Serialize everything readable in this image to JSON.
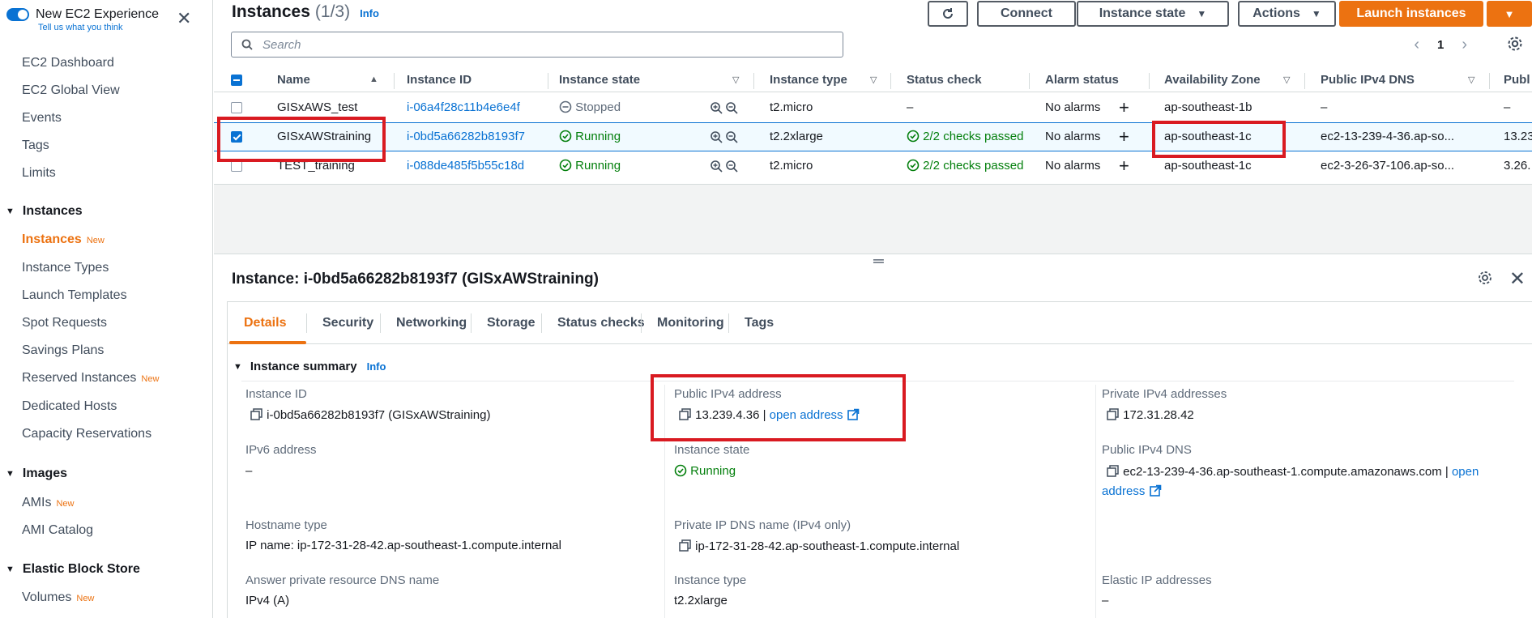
{
  "sidebar": {
    "toggle_title": "New EC2 Experience",
    "toggle_sub": "Tell us what you think",
    "items_top": [
      "EC2 Dashboard",
      "EC2 Global View",
      "Events",
      "Tags",
      "Limits"
    ],
    "section_instances": "Instances",
    "instances_items": [
      "Instances",
      "Instance Types",
      "Launch Templates",
      "Spot Requests",
      "Savings Plans",
      "Reserved Instances",
      "Dedicated Hosts",
      "Capacity Reservations"
    ],
    "section_images": "Images",
    "images_items": [
      "AMIs",
      "AMI Catalog"
    ],
    "section_ebs": "Elastic Block Store",
    "ebs_items": [
      "Volumes"
    ],
    "new_badge": "New"
  },
  "header": {
    "title": "Instances",
    "count": "(1/3)",
    "info": "Info",
    "connect": "Connect",
    "instance_state": "Instance state",
    "actions": "Actions",
    "launch": "Launch instances",
    "search_placeholder": "Search",
    "page": "1"
  },
  "table": {
    "columns": [
      "Name",
      "Instance ID",
      "Instance state",
      "Instance type",
      "Status check",
      "Alarm status",
      "Availability Zone",
      "Public IPv4 DNS",
      "Publ"
    ],
    "rows": [
      {
        "name": "GISxAWS_test",
        "id": "i-06a4f28c11b4e6e4f",
        "state": "Stopped",
        "type": "t2.micro",
        "status": "–",
        "alarm": "No alarms",
        "az_prefix": "ap-southeast-",
        "az_suffix": "1b",
        "dns": "–",
        "ip": "–"
      },
      {
        "name": "GISxAWStraining",
        "id": "i-0bd5a66282b8193f7",
        "state": "Running",
        "type": "t2.2xlarge",
        "status": "2/2 checks passed",
        "alarm": "No alarms",
        "az_prefix": "ap-southeast-",
        "az_suffix": "1c",
        "dns": "ec2-13-239-4-36.ap-so...",
        "ip": "13.23"
      },
      {
        "name": "TEST_training",
        "id": "i-088de485f5b55c18d",
        "state": "Running",
        "type": "t2.micro",
        "status": "2/2 checks passed",
        "alarm": "No alarms",
        "az_prefix": "ap-southeast-",
        "az_suffix": "1c",
        "dns": "ec2-3-26-37-106.ap-so...",
        "ip": "3.26."
      }
    ]
  },
  "details": {
    "title": "Instance: i-0bd5a66282b8193f7 (GISxAWStraining)",
    "tabs": [
      "Details",
      "Security",
      "Networking",
      "Storage",
      "Status checks",
      "Monitoring",
      "Tags"
    ],
    "summary": "Instance summary",
    "info": "Info",
    "instance_id_label": "Instance ID",
    "instance_id_value": "i-0bd5a66282b8193f7 (GISxAWStraining)",
    "public_ipv4_label": "Public IPv4 address",
    "public_ipv4_value": "13.239.4.36",
    "open_address": "open address",
    "private_ipv4_label": "Private IPv4 addresses",
    "private_ipv4_value": "172.31.28.42",
    "ipv6_label": "IPv6 address",
    "ipv6_value": "–",
    "instance_state_label": "Instance state",
    "instance_state_value": "Running",
    "public_dns_label": "Public IPv4 DNS",
    "public_dns_value": "ec2-13-239-4-36.ap-southeast-1.compute.amazonaws.com",
    "public_dns_link_1": "open",
    "public_dns_link_2": "address",
    "hostname_type_label": "Hostname type",
    "hostname_type_value": "IP name: ip-172-31-28-42.ap-southeast-1.compute.internal",
    "private_dns_label": "Private IP DNS name (IPv4 only)",
    "private_dns_value": "ip-172-31-28-42.ap-southeast-1.compute.internal",
    "answer_dns_label": "Answer private resource DNS name",
    "answer_dns_value": "IPv4 (A)",
    "instance_type_label": "Instance type",
    "instance_type_value": "t2.2xlarge",
    "elastic_ip_label": "Elastic IP addresses",
    "elastic_ip_value": "–"
  },
  "colors": {
    "accent": "#ec7211",
    "link": "#0972d3",
    "success": "#037f0c",
    "highlight": "#d91a21"
  }
}
